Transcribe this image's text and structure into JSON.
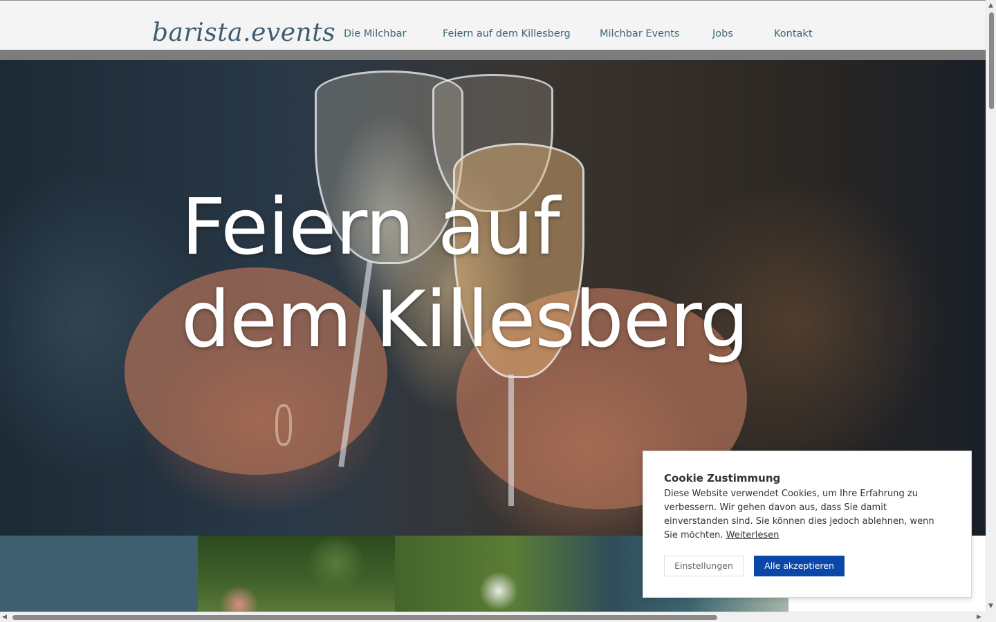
{
  "header": {
    "logo_text": "barista.events",
    "nav": [
      {
        "label": "Die Milchbar"
      },
      {
        "label": "Feiern auf dem Killesberg"
      },
      {
        "label": "Milchbar Events"
      },
      {
        "label": "Jobs"
      },
      {
        "label": "Kontakt"
      }
    ]
  },
  "hero": {
    "title_line1": "Feiern auf",
    "title_line2": "dem Killesberg"
  },
  "cookie": {
    "title": "Cookie Zustimmung",
    "text": "Diese Website verwendet Cookies, um Ihre Erfahrung zu verbessern. Wir gehen davon aus, dass Sie damit einverstanden sind. Sie können dies jedoch ablehnen, wenn Sie möchten.",
    "read_more": "Weiterlesen",
    "settings_button": "Einstellungen",
    "accept_button": "Alle akzeptieren"
  },
  "scrollbars": {
    "left_arrow": "◀",
    "right_arrow": "▶",
    "up_arrow": "▲",
    "down_arrow": "▼"
  },
  "colors": {
    "brand": "#3e5d6f",
    "nav_text": "#3c6478",
    "accept_button": "#0b47a8",
    "teal_panel": "#3e5f6e"
  }
}
